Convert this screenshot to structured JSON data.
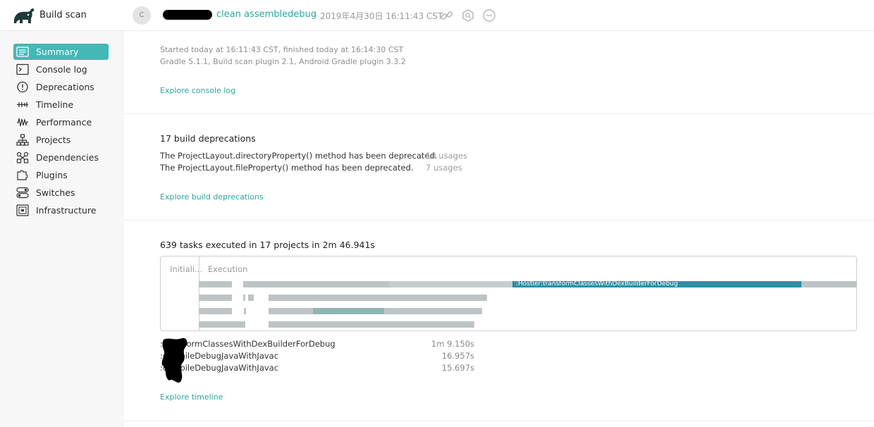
{
  "header": {
    "brand": "Build scan",
    "avatar_letter": "C",
    "scan_title": "clean assembledebug",
    "scan_date": "2019年4月30日 16:11:43 CST",
    "icons": [
      "link-icon",
      "scan-settings-icon",
      "collapse-icon"
    ]
  },
  "sidebar": {
    "items": [
      {
        "label": "Summary",
        "icon": "summary-icon",
        "active": true
      },
      {
        "label": "Console log",
        "icon": "console-icon"
      },
      {
        "label": "Deprecations",
        "icon": "deprecations-icon"
      },
      {
        "label": "Timeline",
        "icon": "timeline-icon"
      },
      {
        "label": "Performance",
        "icon": "performance-icon"
      },
      {
        "label": "Projects",
        "icon": "projects-icon"
      },
      {
        "label": "Dependencies",
        "icon": "dependencies-icon"
      },
      {
        "label": "Plugins",
        "icon": "plugins-icon"
      },
      {
        "label": "Switches",
        "icon": "switches-icon"
      },
      {
        "label": "Infrastructure",
        "icon": "infrastructure-icon"
      }
    ]
  },
  "summary": {
    "started": "Started today at 16:11:43 CST, finished today at 16:14:30 CST",
    "versions": "Gradle 5.1.1,  Build scan plugin 2.1,  Android Gradle plugin 3.3.2",
    "console_link": "Explore console log"
  },
  "deprecations": {
    "heading": "17 build deprecations",
    "rows": [
      {
        "text": "The ProjectLayout.directoryProperty() method has been deprecated.",
        "count": "10 usages"
      },
      {
        "text": "The ProjectLayout.fileProperty() method has been deprecated.",
        "count": "7 usages"
      }
    ],
    "link": "Explore build deprecations"
  },
  "tasks": {
    "heading": "639 tasks executed in 17 projects in 2m 46.941s",
    "timeline": {
      "initialization_label": "Initiali...",
      "execution_label": "Execution",
      "highlight_task": ":Hostler:transformClassesWithDexBuilderForDebug"
    },
    "slowest": [
      {
        "name": ":transformClassesWithDexBuilderForDebug",
        "duration": "1m 9.150s"
      },
      {
        "name": ":compileDebugJavaWithJavac",
        "duration": "16.957s"
      },
      {
        "name": ":compileDebugJavaWithJavac",
        "duration": "15.697s"
      }
    ],
    "link": "Explore timeline"
  },
  "colors": {
    "accent": "#2aa89a",
    "active_nav": "#43b8b6",
    "highlight_bar": "#2f8fa3"
  }
}
